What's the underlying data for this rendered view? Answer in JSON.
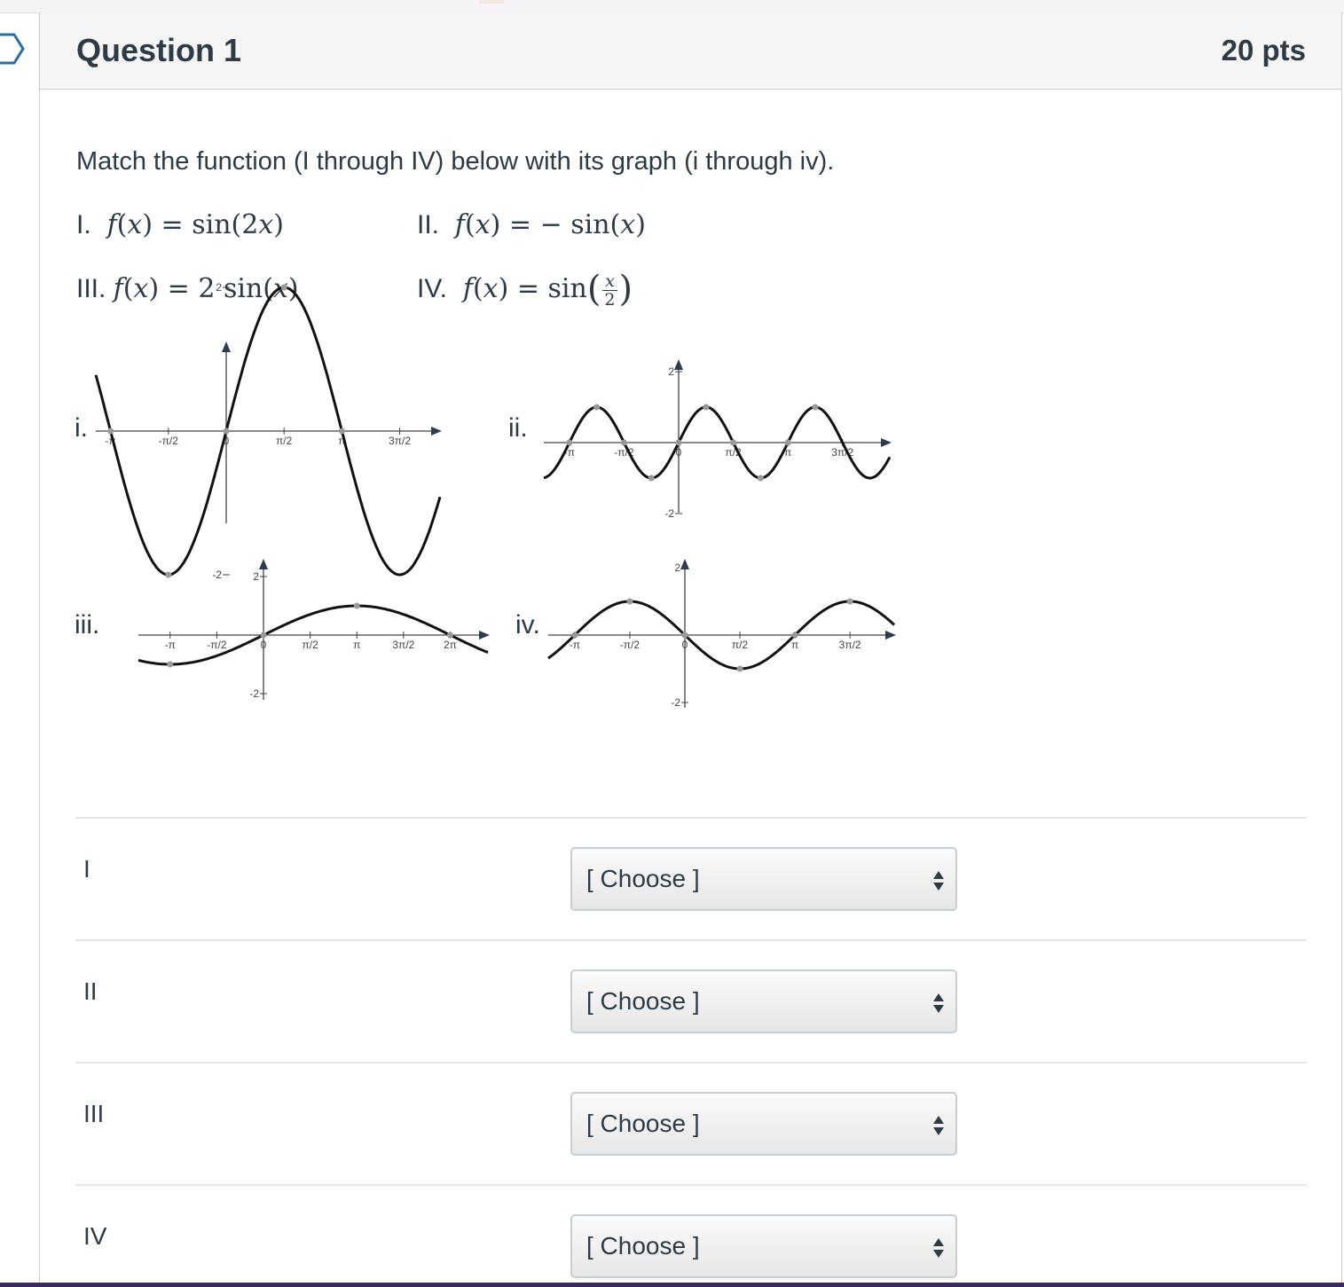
{
  "question": {
    "title": "Question 1",
    "points": "20 pts"
  },
  "prompt": "Match the function (I through IV) below with its graph (i through iv).",
  "functions": [
    {
      "label": "I.",
      "expr": "f(x) = sin(2x)"
    },
    {
      "label": "II.",
      "expr": "f(x) = − sin(x)"
    },
    {
      "label": "III.",
      "expr": "f(x) = 2 sin(x)"
    },
    {
      "label": "IV.",
      "expr": "f(x) = sin(x/2)"
    }
  ],
  "graph_labels": [
    "i.",
    "ii.",
    "iii.",
    "iv."
  ],
  "chart_data": [
    {
      "name": "i.",
      "type": "line",
      "function": "2 sin(x)",
      "xlim": [
        -3.14,
        3.8
      ],
      "ylim": [
        -2,
        2
      ],
      "x_ticks": [
        "-π",
        "-π/2",
        "0",
        "π/2",
        "π",
        "3π/2"
      ],
      "y_ticks": [
        "2",
        "-2"
      ],
      "xlabel": "",
      "ylabel": ""
    },
    {
      "name": "ii.",
      "type": "line",
      "function": "sin(2x)",
      "xlim": [
        -3.14,
        4
      ],
      "ylim": [
        -2,
        2
      ],
      "x_ticks": [
        "-π",
        "-π/2",
        "0",
        "π/2",
        "π",
        "3π/2"
      ],
      "y_ticks": [
        "2",
        "-2"
      ],
      "xlabel": "",
      "ylabel": ""
    },
    {
      "name": "iii.",
      "type": "line",
      "function": "sin(x/2)",
      "xlim": [
        -3.14,
        7.2
      ],
      "ylim": [
        -2,
        2
      ],
      "x_ticks": [
        "-π",
        "-π/2",
        "0",
        "π/2",
        "π",
        "3π/2",
        "2π"
      ],
      "y_ticks": [
        "2",
        "-2"
      ],
      "xlabel": "",
      "ylabel": ""
    },
    {
      "name": "iv.",
      "type": "line",
      "function": "-sin(x)",
      "xlim": [
        -3.14,
        5.7
      ],
      "ylim": [
        -2,
        2
      ],
      "x_ticks": [
        "-π",
        "-π/2",
        "0",
        "π/2",
        "π",
        "3π/2"
      ],
      "y_ticks": [
        "2",
        "-2"
      ],
      "xlabel": "",
      "ylabel": ""
    }
  ],
  "answers": [
    {
      "label": "I",
      "value": "[ Choose ]"
    },
    {
      "label": "II",
      "value": "[ Choose ]"
    },
    {
      "label": "III",
      "value": "[ Choose ]"
    },
    {
      "label": "IV",
      "value": "[ Choose ]"
    }
  ]
}
